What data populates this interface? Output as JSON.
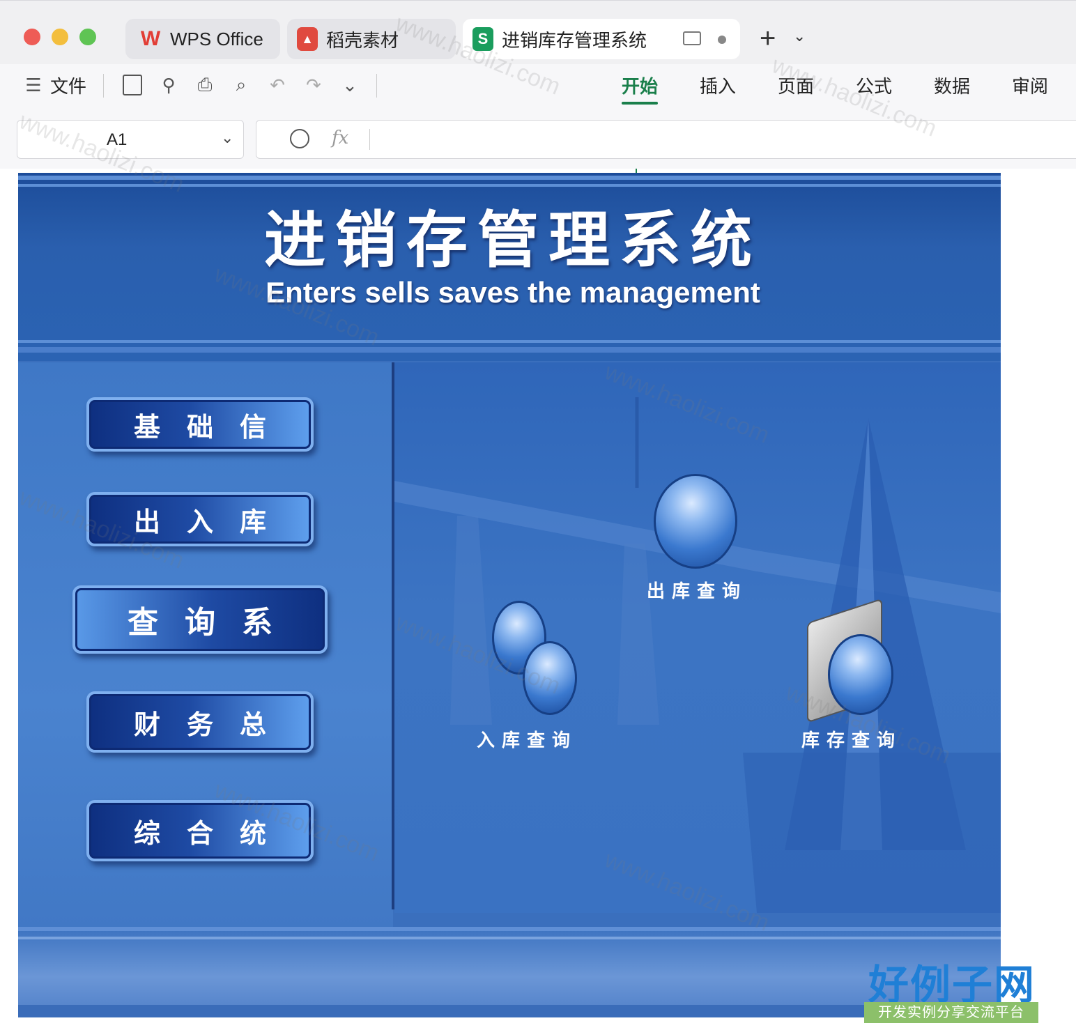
{
  "window": {
    "tabs": [
      {
        "label": "WPS Office",
        "icon": "wps-logo-icon"
      },
      {
        "label": "稻壳素材",
        "icon": "docer-icon"
      },
      {
        "label": "进销库存管理系统",
        "icon": "spreadsheet-s-icon",
        "active": true
      }
    ]
  },
  "toolbar": {
    "file_label": "文件",
    "ribbon_tabs": [
      "开始",
      "插入",
      "页面",
      "公式",
      "数据",
      "审阅"
    ],
    "active_tab": "开始"
  },
  "formula_bar": {
    "cell_ref": "A1",
    "fx_label": "fx",
    "value": ""
  },
  "app": {
    "title_cn": "进销存管理系统",
    "title_en": "Enters sells saves the management",
    "nav_buttons": [
      {
        "label": "基础信",
        "selected": false
      },
      {
        "label": "出入库",
        "selected": false
      },
      {
        "label": "查询系",
        "selected": true
      },
      {
        "label": "财务总",
        "selected": false
      },
      {
        "label": "综合统",
        "selected": false
      }
    ],
    "queries": {
      "outbound": "出库查询",
      "inbound": "入库查询",
      "stock": "库存查询"
    }
  },
  "watermark": {
    "text": "www.haolizi.com",
    "logo_main": "好例子网",
    "logo_sub": "开发实例分享交流平台"
  },
  "colors": {
    "accent_green": "#1a7f4b",
    "app_blue": "#3a6fbd",
    "nav_dark": "#0e2f80",
    "logo_blue": "#1f7fd6"
  }
}
